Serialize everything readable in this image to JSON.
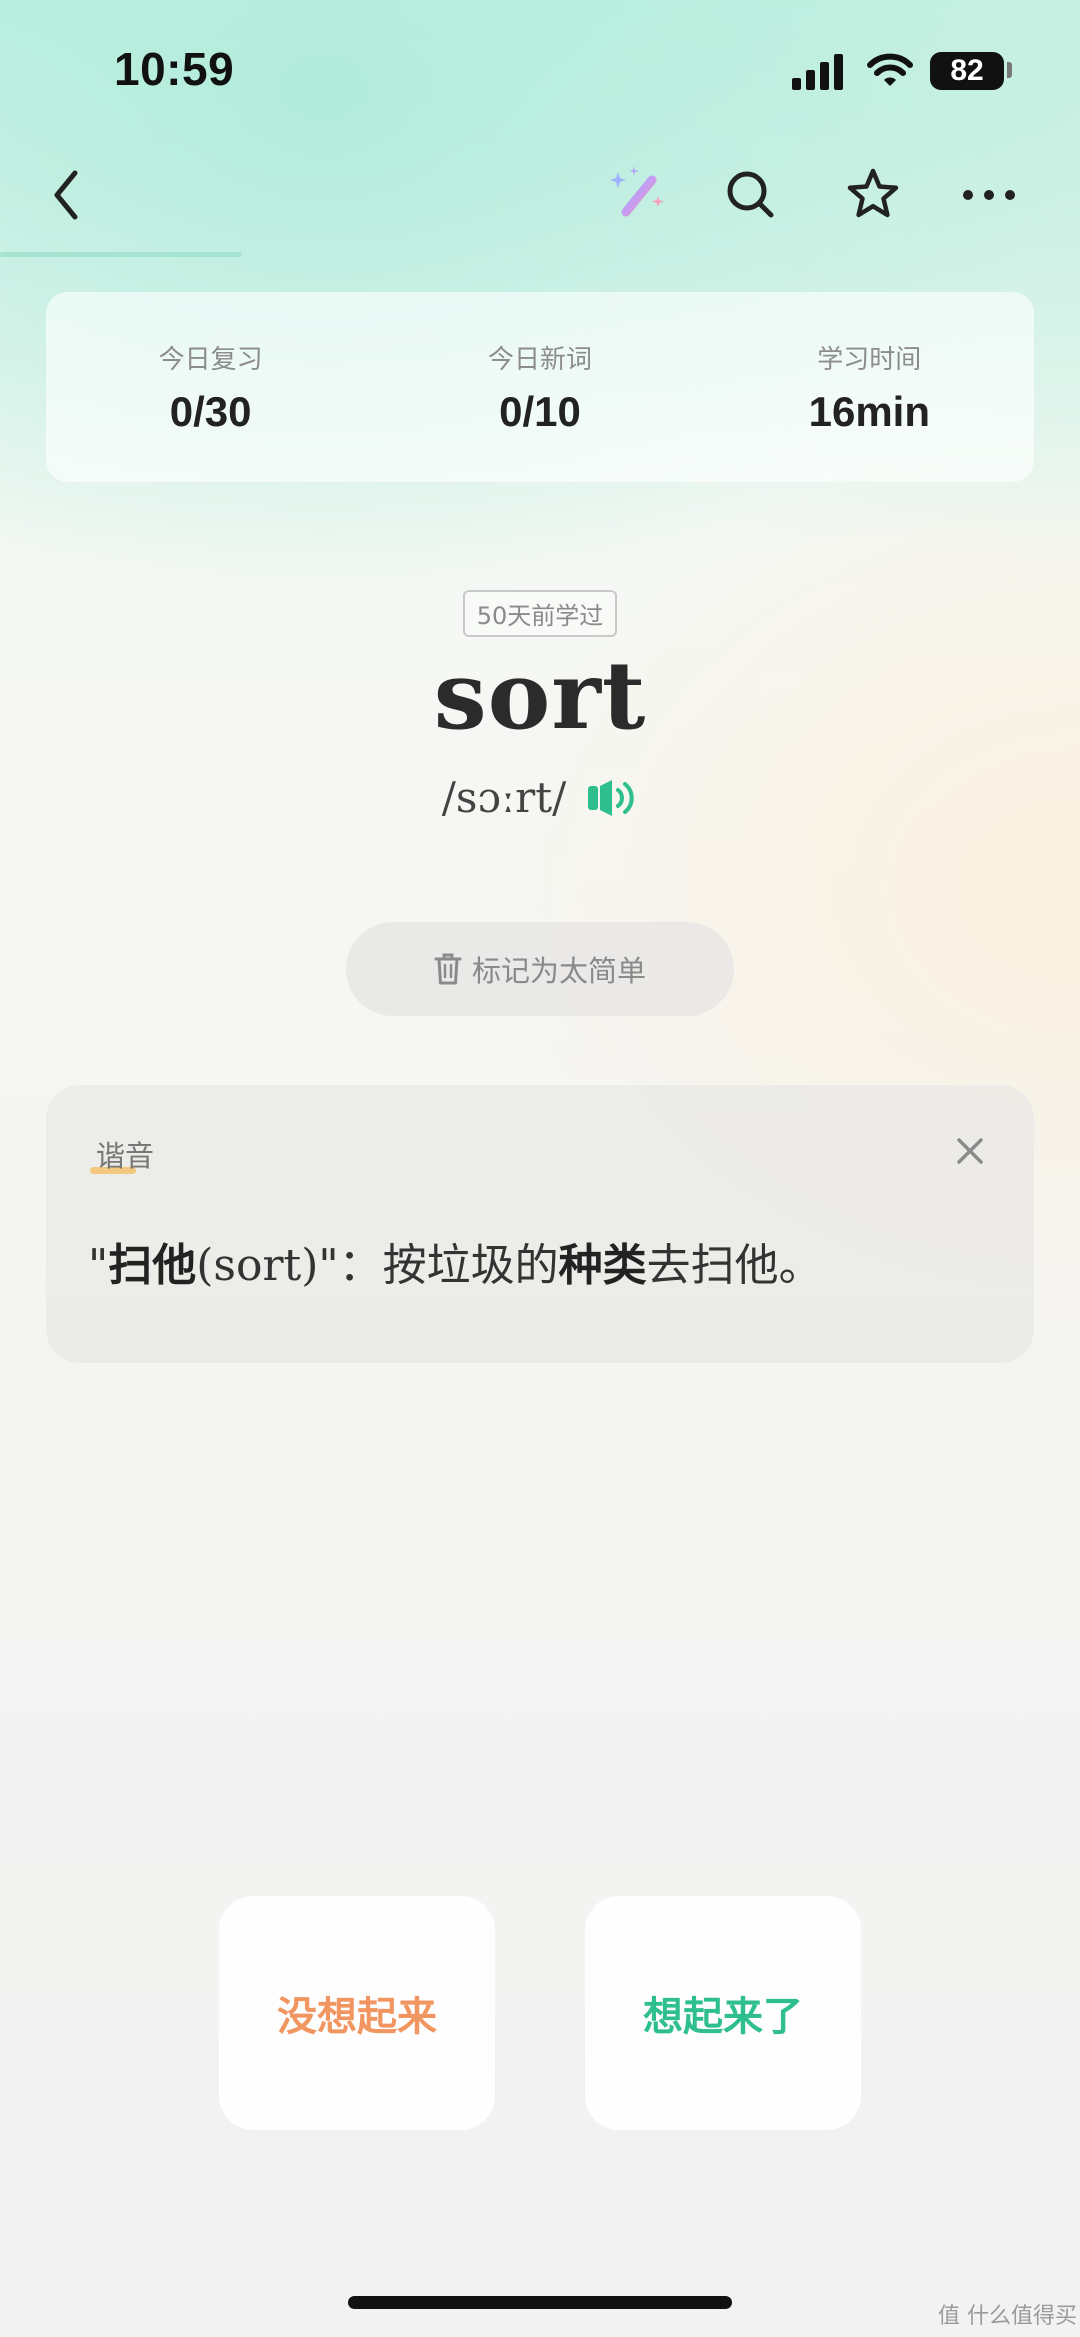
{
  "status_bar": {
    "time": "10:59",
    "battery": "82"
  },
  "nav": {
    "back_icon": "chevron-left-icon",
    "magic_icon": "magic-wand-icon",
    "search_icon": "search-icon",
    "star_icon": "star-icon",
    "more_icon": "more-dots-icon"
  },
  "stats": [
    {
      "label": "今日复习",
      "value": "0/30"
    },
    {
      "label": "今日新词",
      "value": "0/10"
    },
    {
      "label": "学习时间",
      "value": "16min"
    }
  ],
  "word_card": {
    "learned_badge": "50天前学过",
    "word": "sort",
    "phonetic": "/sɔːrt/",
    "speaker_icon": "speaker-icon"
  },
  "mark_easy": {
    "label": "标记为太简单",
    "icon": "trash-icon"
  },
  "mnemonic": {
    "title": "谐音",
    "text_parts": {
      "open_quote": "\"",
      "bold1": "扫他",
      "paren": "(sort)",
      "mid": "\"：按垃圾的",
      "bold2": "种类",
      "end": "去扫他。"
    },
    "close_icon": "close-icon"
  },
  "answers": {
    "forgot_label": "没想起来",
    "remember_label": "想起来了"
  },
  "colors": {
    "accent_green": "#2fbf8e",
    "accent_orange": "#f19561"
  },
  "watermark": "值 什么值得买"
}
